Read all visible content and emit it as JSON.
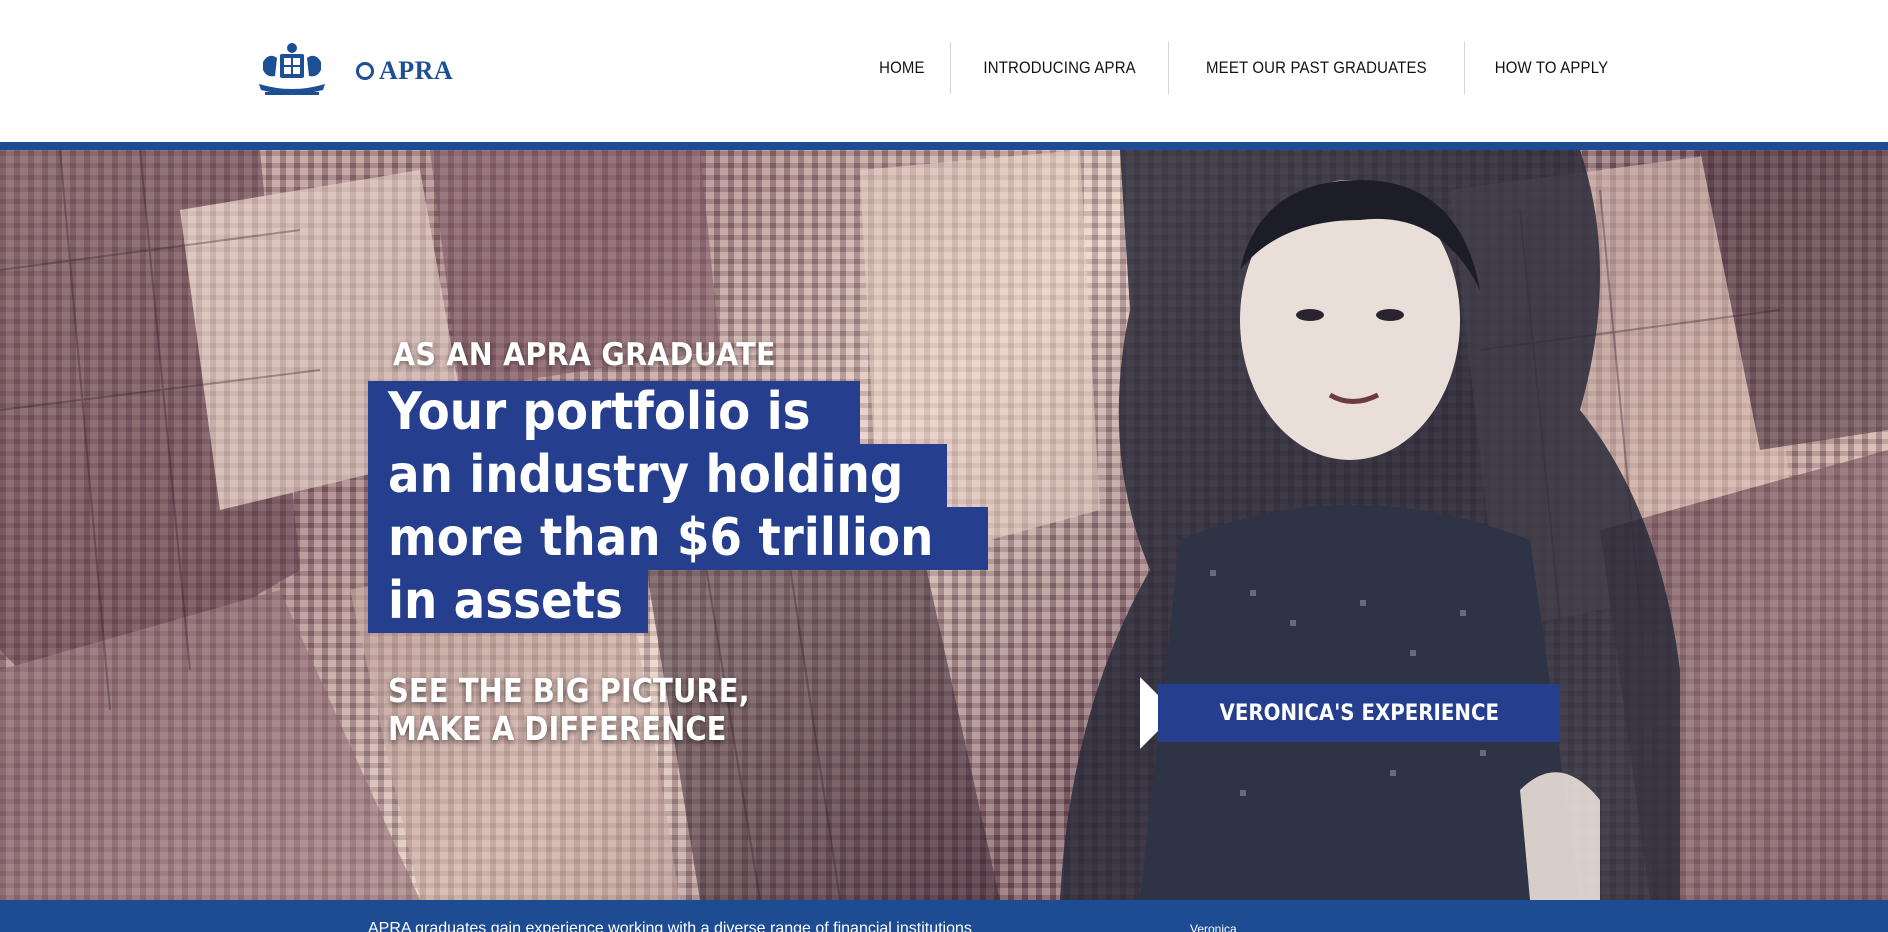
{
  "header": {
    "logo_text": "APRA",
    "nav": [
      {
        "label": "HOME"
      },
      {
        "label": "INTRODUCING APRA"
      },
      {
        "label": "MEET OUR PAST GRADUATES"
      },
      {
        "label": "HOW TO APPLY"
      }
    ]
  },
  "hero": {
    "kicker": "AS AN APRA GRADUATE",
    "headline_lines": [
      "Your portfolio is",
      "an industry holding",
      "more than $6 trillion",
      "in assets"
    ],
    "tagline_lines": [
      "SEE THE BIG PICTURE,",
      "MAKE A DIFFERENCE"
    ],
    "cta_label": "VERONICA'S EXPERIENCE"
  },
  "footer": {
    "text": "APRA graduates gain experience working with a diverse range of financial institutions",
    "link": "Veronica"
  },
  "colors": {
    "brand_blue": "#1d4c93",
    "headline_bg": "#253f8e",
    "text_white": "#ffffff"
  }
}
